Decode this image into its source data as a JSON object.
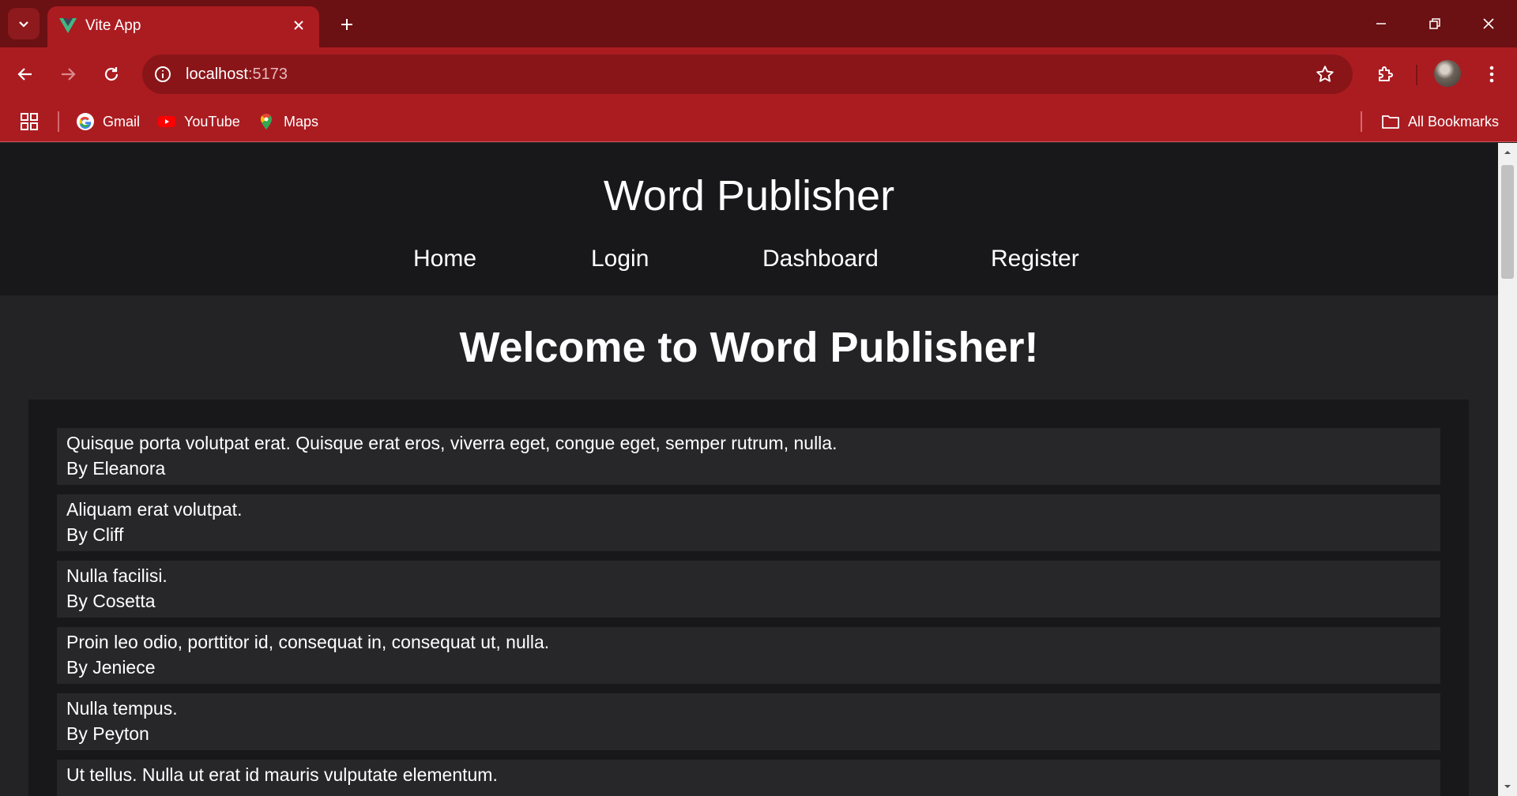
{
  "browser": {
    "tab": {
      "title": "Vite App"
    },
    "omnibox": {
      "host": "localhost",
      "port": ":5173"
    },
    "bookmarks": [
      {
        "label": "Gmail",
        "icon": "google-icon"
      },
      {
        "label": "YouTube",
        "icon": "youtube-icon"
      },
      {
        "label": "Maps",
        "icon": "maps-icon"
      }
    ],
    "all_bookmarks_label": "All Bookmarks"
  },
  "site": {
    "title": "Word Publisher",
    "nav": [
      "Home",
      "Login",
      "Dashboard",
      "Register"
    ],
    "welcome": "Welcome to Word Publisher!"
  },
  "posts": [
    {
      "text": "Quisque porta volutpat erat. Quisque erat eros, viverra eget, congue eget, semper rutrum, nulla.",
      "author": "By Eleanora"
    },
    {
      "text": "Aliquam erat volutpat.",
      "author": "By Cliff"
    },
    {
      "text": "Nulla facilisi.",
      "author": "By Cosetta"
    },
    {
      "text": "Proin leo odio, porttitor id, consequat in, consequat ut, nulla.",
      "author": "By Jeniece"
    },
    {
      "text": "Nulla tempus.",
      "author": "By Peyton"
    },
    {
      "text": "Ut tellus. Nulla ut erat id mauris vulputate elementum.",
      "author": ""
    }
  ],
  "colors": {
    "tabbar": "#6b1013",
    "toolbar": "#ab1c21",
    "header_bg": "#18181b",
    "page_bg": "#232326",
    "post_bg": "#27272a"
  }
}
